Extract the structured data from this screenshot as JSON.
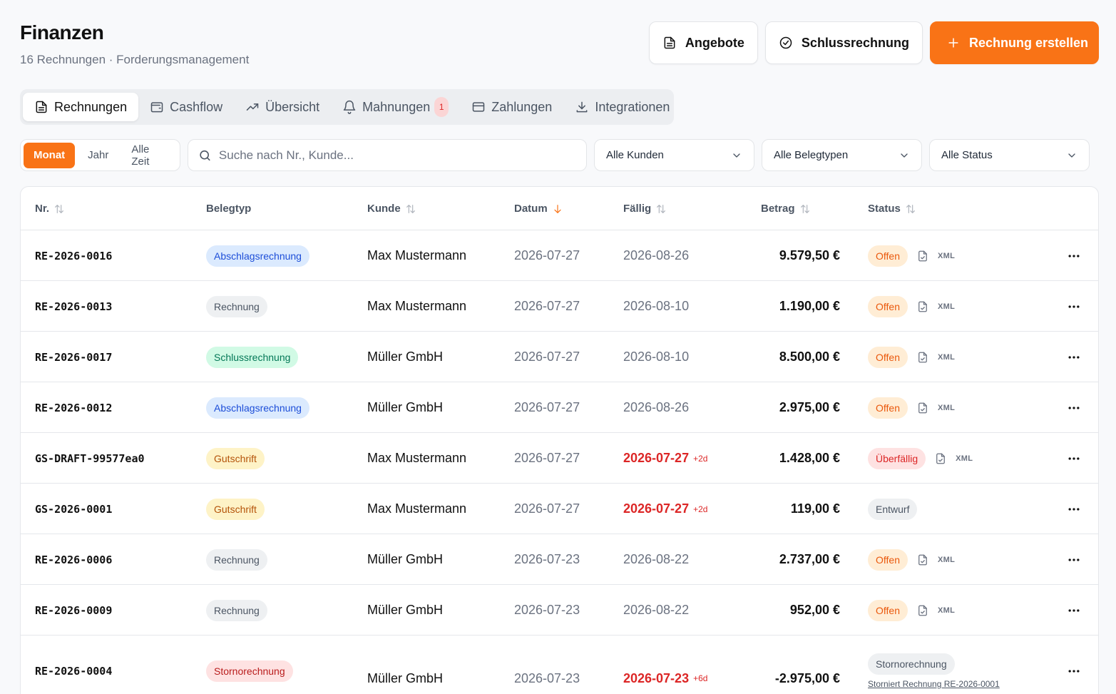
{
  "header": {
    "title": "Finanzen",
    "subtitle": "16 Rechnungen · Forderungsmanagement",
    "btn_angebote": "Angebote",
    "btn_schluss": "Schlussrechnung",
    "btn_create": "Rechnung erstellen"
  },
  "tabs": [
    {
      "label": "Rechnungen",
      "icon": "file-text-icon",
      "active": true
    },
    {
      "label": "Cashflow",
      "icon": "wallet-icon"
    },
    {
      "label": "Übersicht",
      "icon": "trending-up-icon"
    },
    {
      "label": "Mahnungen",
      "icon": "bell-icon",
      "badge": "1"
    },
    {
      "label": "Zahlungen",
      "icon": "credit-card-icon"
    },
    {
      "label": "Integrationen",
      "icon": "download-icon"
    }
  ],
  "filters": {
    "period": [
      "Monat",
      "Jahr",
      "Alle Zeit"
    ],
    "period_active": "Monat",
    "search_placeholder": "Suche nach Nr., Kunde...",
    "kunden": "Alle Kunden",
    "belegtypen": "Alle Belegtypen",
    "status": "Alle Status"
  },
  "table": {
    "columns": {
      "nr": "Nr.",
      "belegtyp": "Belegtyp",
      "kunde": "Kunde",
      "datum": "Datum",
      "faellig": "Fällig",
      "betrag": "Betrag",
      "status": "Status"
    },
    "xml_label": "XML",
    "rows": [
      {
        "nr": "RE-2026-0016",
        "typ": "Abschlagsrechnung",
        "kunde": "Max Mustermann",
        "datum": "2026-07-27",
        "faellig": "2026-08-26",
        "days": "",
        "betrag": "9.579,50 €",
        "status": "Offen"
      },
      {
        "nr": "RE-2026-0013",
        "typ": "Rechnung",
        "kunde": "Max Mustermann",
        "datum": "2026-07-27",
        "faellig": "2026-08-10",
        "days": "",
        "betrag": "1.190,00 €",
        "status": "Offen"
      },
      {
        "nr": "RE-2026-0017",
        "typ": "Schlussrechnung",
        "kunde": "Müller GmbH",
        "datum": "2026-07-27",
        "faellig": "2026-08-10",
        "days": "",
        "betrag": "8.500,00 €",
        "status": "Offen"
      },
      {
        "nr": "RE-2026-0012",
        "typ": "Abschlagsrechnung",
        "kunde": "Müller GmbH",
        "datum": "2026-07-27",
        "faellig": "2026-08-26",
        "days": "",
        "betrag": "2.975,00 €",
        "status": "Offen"
      },
      {
        "nr": "GS-DRAFT-99577ea0",
        "typ": "Gutschrift",
        "kunde": "Max Mustermann",
        "datum": "2026-07-27",
        "faellig": "2026-07-27",
        "days": "+2d",
        "betrag": "1.428,00 €",
        "status": "Überfällig"
      },
      {
        "nr": "GS-2026-0001",
        "typ": "Gutschrift",
        "kunde": "Max Mustermann",
        "datum": "2026-07-27",
        "faellig": "2026-07-27",
        "days": "+2d",
        "betrag": "119,00 €",
        "status": "Entwurf"
      },
      {
        "nr": "RE-2026-0006",
        "typ": "Rechnung",
        "kunde": "Müller GmbH",
        "datum": "2026-07-23",
        "faellig": "2026-08-22",
        "days": "",
        "betrag": "2.737,00 €",
        "status": "Offen"
      },
      {
        "nr": "RE-2026-0009",
        "typ": "Rechnung",
        "kunde": "Müller GmbH",
        "datum": "2026-07-23",
        "faellig": "2026-08-22",
        "days": "",
        "betrag": "952,00 €",
        "status": "Offen"
      },
      {
        "nr": "RE-2026-0004",
        "typ": "Stornorechnung",
        "kunde": "Müller GmbH",
        "datum": "2026-07-23",
        "faellig": "2026-07-23",
        "days": "+6d",
        "betrag": "-2.975,00 €",
        "status": "Stornorechnung",
        "status_note": "Storniert Rechnung RE-2026-0001"
      }
    ]
  },
  "colors": {
    "accent": "#f97316",
    "overdue": "#dc2626"
  }
}
